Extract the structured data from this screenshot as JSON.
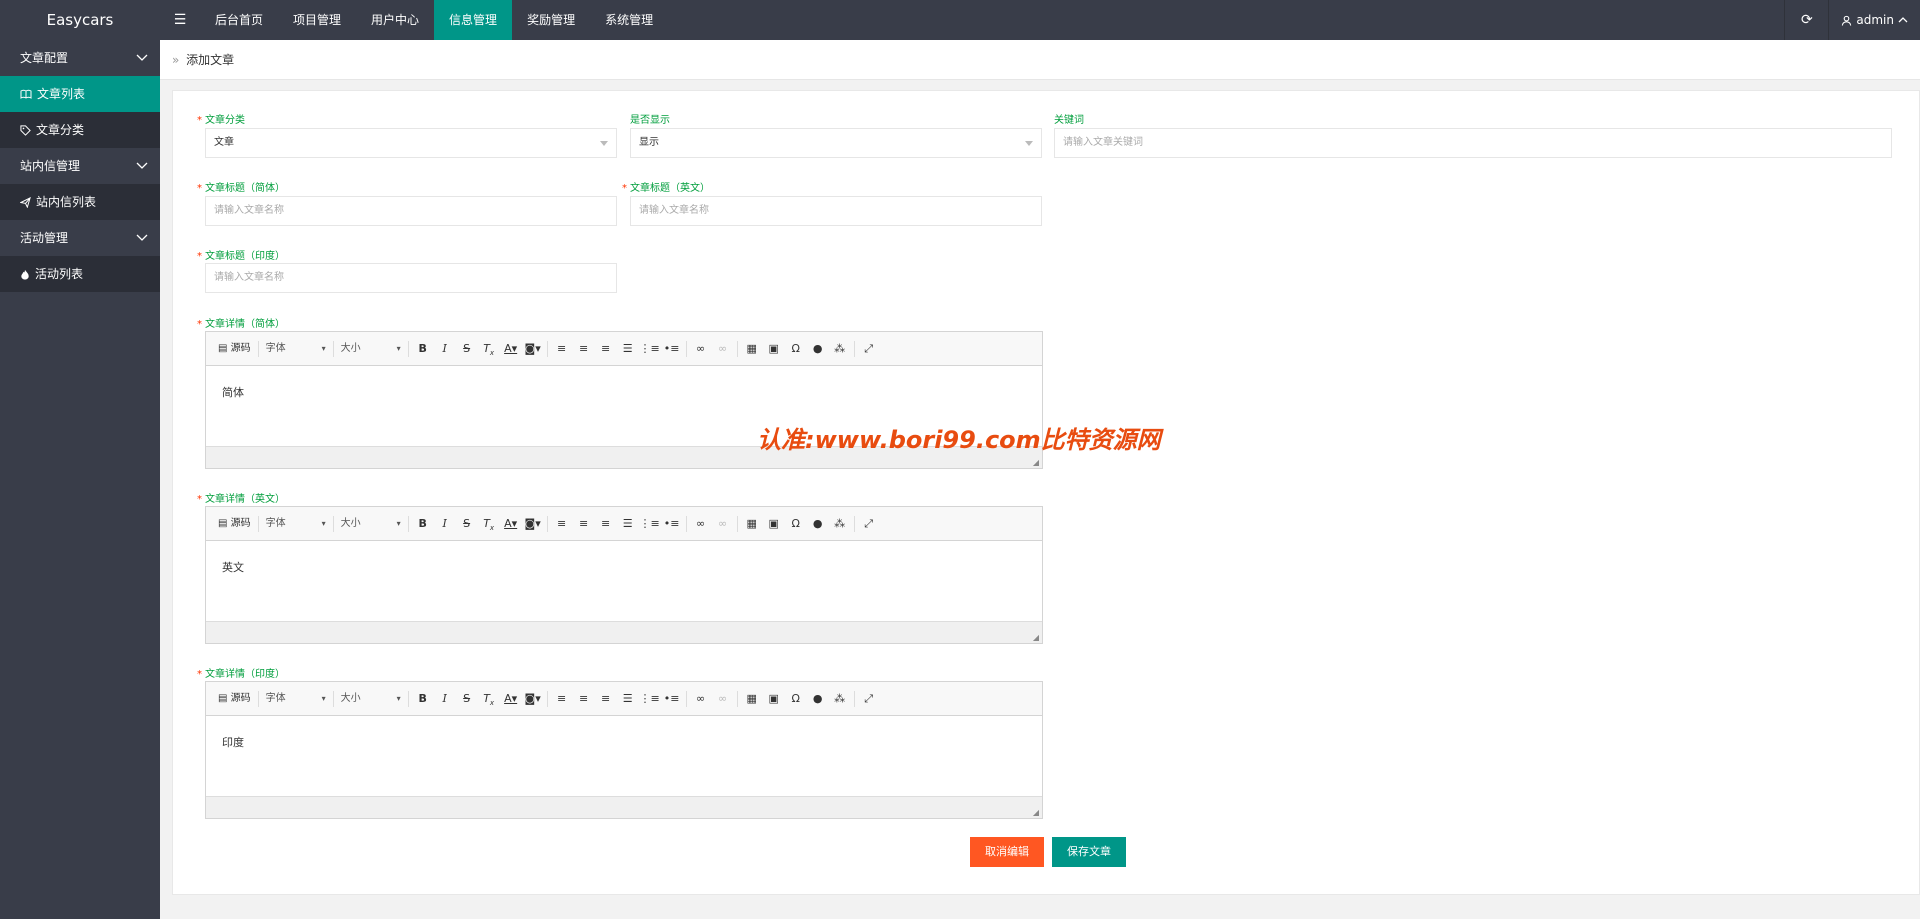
{
  "app": {
    "logo": "Easycars"
  },
  "topnav": {
    "toggle": "☰",
    "items": [
      {
        "label": "后台首页"
      },
      {
        "label": "项目管理"
      },
      {
        "label": "用户中心"
      },
      {
        "label": "信息管理"
      },
      {
        "label": "奖励管理"
      },
      {
        "label": "系统管理"
      }
    ],
    "active": "信息管理",
    "refresh_icon": "⟳",
    "user": "admin"
  },
  "sidebar": {
    "groups": [
      {
        "label": "文章配置",
        "items": [
          {
            "label": "文章列表",
            "icon": "book-icon"
          },
          {
            "label": "文章分类",
            "icon": "tag-icon"
          }
        ]
      },
      {
        "label": "站内信管理",
        "items": [
          {
            "label": "站内信列表",
            "icon": "send-icon"
          }
        ]
      },
      {
        "label": "活动管理",
        "items": [
          {
            "label": "活动列表",
            "icon": "fire-icon"
          }
        ]
      }
    ],
    "active_item": "文章列表"
  },
  "breadcrumb": {
    "current": "添加文章"
  },
  "form": {
    "category": {
      "label": "文章分类",
      "value": "文章"
    },
    "show": {
      "label": "是否显示",
      "value": "显示"
    },
    "keywords": {
      "label": "关键词",
      "placeholder": "请输入文章关键词"
    },
    "title_cn": {
      "label": "文章标题（简体）",
      "placeholder": "请输入文章名称"
    },
    "title_en": {
      "label": "文章标题（英文）",
      "placeholder": "请输入文章名称"
    },
    "title_in": {
      "label": "文章标题（印度）",
      "placeholder": "请输入文章名称"
    },
    "detail_cn": {
      "label": "文章详情（简体）",
      "content": "简体"
    },
    "detail_en": {
      "label": "文章详情（英文）",
      "content": "英文"
    },
    "detail_in": {
      "label": "文章详情（印度）",
      "content": "印度"
    }
  },
  "editor_toolbar": {
    "source": "源码",
    "font": "字体",
    "size": "大小"
  },
  "buttons": {
    "cancel": "取消编辑",
    "save": "保存文章"
  },
  "colors": {
    "accent": "#009688",
    "cancel": "#ff5722",
    "dark": "#393d49",
    "label": "#009e3c"
  },
  "watermark": "认准:www.bori99.com比特资源网"
}
